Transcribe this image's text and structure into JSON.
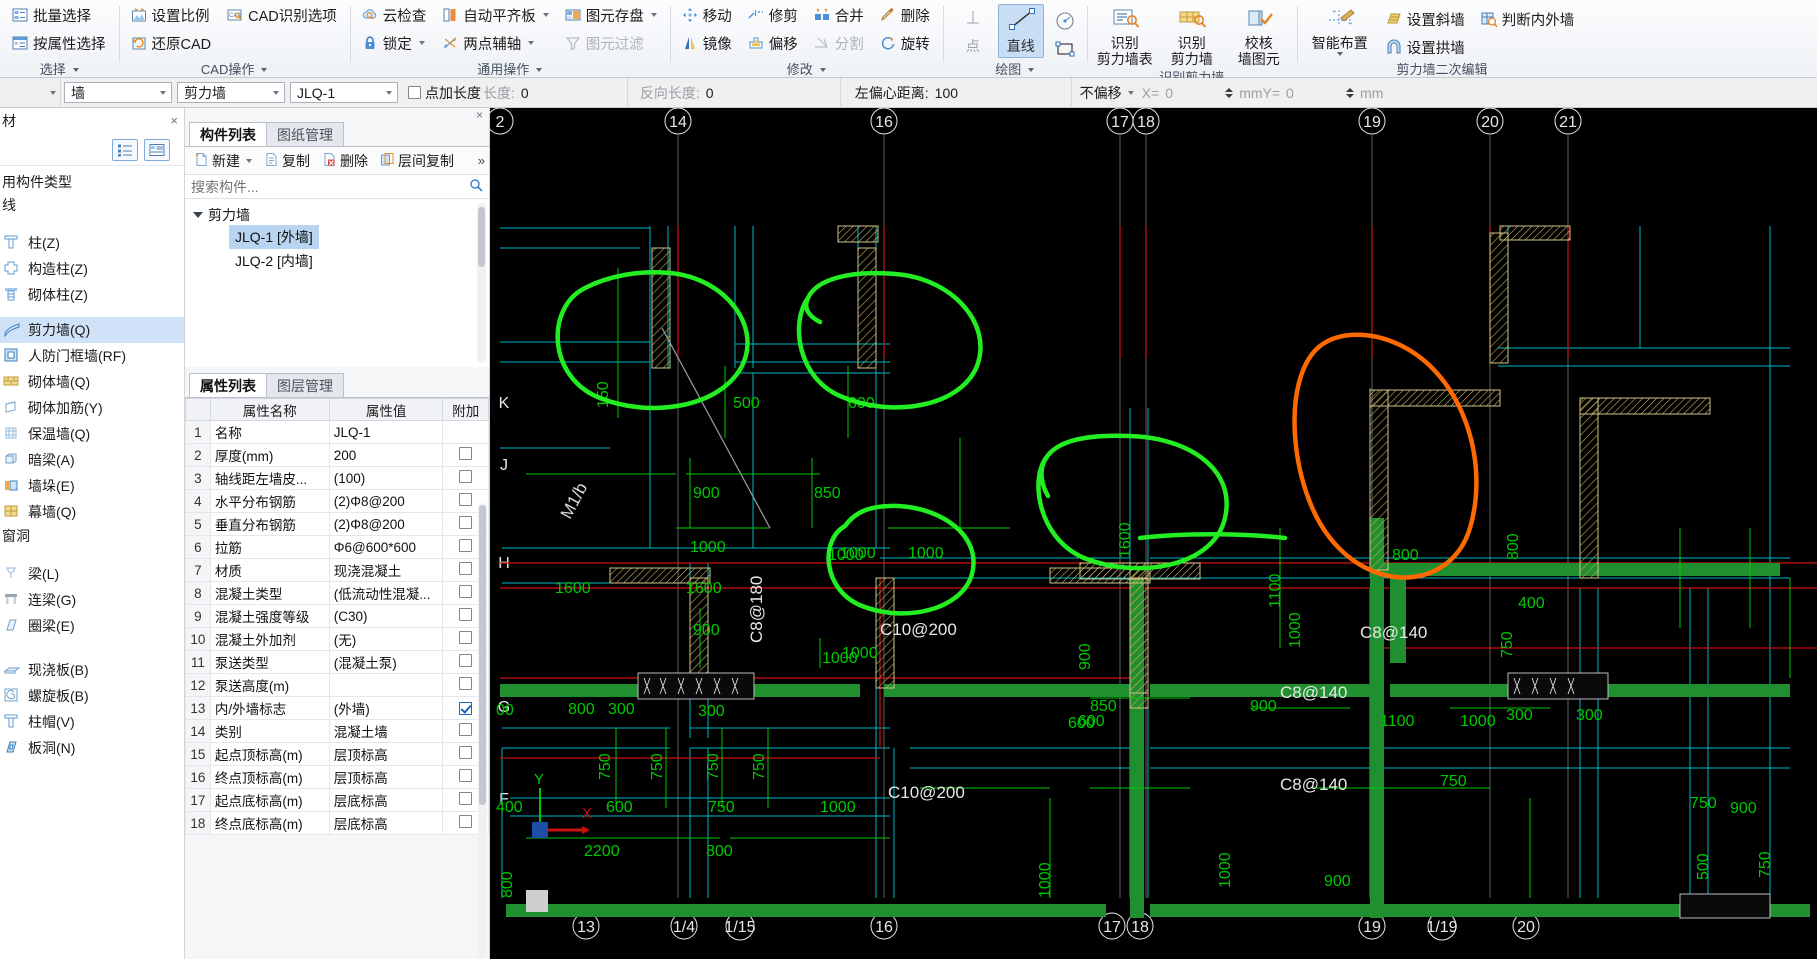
{
  "ribbon": {
    "groups": [
      {
        "title": "选择",
        "items": [
          {
            "label": "批量选择",
            "icon": "batch-select-icon"
          },
          {
            "label": "按属性选择",
            "icon": "select-by-attribute-icon"
          }
        ]
      },
      {
        "title": "CAD操作",
        "items": [
          {
            "label": "设置比例",
            "icon": "set-scale-icon"
          },
          {
            "label": "还原CAD",
            "icon": "restore-cad-icon"
          },
          {
            "label": "CAD识别选项",
            "icon": "cad-recognize-options-icon"
          }
        ]
      },
      {
        "title": "通用操作",
        "items": [
          {
            "label": "云检查",
            "icon": "cloud-check-icon"
          },
          {
            "label": "锁定",
            "icon": "lock-icon"
          },
          {
            "label": "自动平齐板",
            "icon": "auto-align-slab-icon"
          },
          {
            "label": "两点辅轴",
            "icon": "two-point-aux-axis-icon"
          },
          {
            "label": "图元存盘",
            "icon": "element-save-icon"
          },
          {
            "label": "图元过滤",
            "icon": "element-filter-icon"
          }
        ]
      },
      {
        "title": "修改",
        "items": [
          {
            "label": "移动",
            "icon": "move-icon"
          },
          {
            "label": "镜像",
            "icon": "mirror-icon"
          },
          {
            "label": "修剪",
            "icon": "trim-icon"
          },
          {
            "label": "偏移",
            "icon": "offset-icon"
          },
          {
            "label": "合并",
            "icon": "merge-icon"
          },
          {
            "label": "分割",
            "icon": "split-icon"
          },
          {
            "label": "删除",
            "icon": "delete-icon"
          },
          {
            "label": "旋转",
            "icon": "rotate-icon"
          }
        ]
      },
      {
        "title": "绘图",
        "items": [
          {
            "label": "点",
            "icon": "point-tool-icon"
          },
          {
            "label": "直线",
            "icon": "line-tool-icon"
          },
          {
            "label": "弧线",
            "icon": "arc-tool-icon"
          },
          {
            "label": "矩形",
            "icon": "rect-tool-icon"
          }
        ]
      },
      {
        "title": "识别剪力墙",
        "items": [
          {
            "label1": "识别",
            "label2": "剪力墙表",
            "icon": "recognize-shearwall-table-icon"
          },
          {
            "label1": "识别",
            "label2": "剪力墙",
            "icon": "recognize-shearwall-icon"
          },
          {
            "label1": "校核",
            "label2": "墙图元",
            "icon": "check-wall-element-icon"
          }
        ]
      },
      {
        "title": "剪力墙二次编辑",
        "items": [
          {
            "label1": "智能布置",
            "icon": "smart-layout-icon"
          },
          {
            "label": "设置斜墙",
            "icon": "set-slanted-wall-icon"
          },
          {
            "label": "设置拱墙",
            "icon": "set-arch-wall-icon"
          },
          {
            "label": "判断内外墙",
            "icon": "judge-inner-outer-wall-icon"
          }
        ]
      }
    ],
    "active_tool": "直线"
  },
  "optionsbar": {
    "first_combo_value": "",
    "combo_wall": "墙",
    "combo_type": "剪力墙",
    "combo_name": "JLQ-1",
    "checkbox_label": "点加长度",
    "length_label": "长度:",
    "length_value": "0",
    "reverse_length_label": "反向长度:",
    "reverse_length_value": "0",
    "left_eccentric_label": "左偏心距离:",
    "left_eccentric_value": "100",
    "offset_mode": "不偏移",
    "x_label": "X=",
    "x_value": "0",
    "x_unit": "mmY=",
    "y_value": "0",
    "y_unit": "mm"
  },
  "leftnav": {
    "header": "材",
    "section_title": "用构件类型",
    "sub_title": "线",
    "groups": [
      {
        "items": [
          {
            "label": "柱(Z)",
            "icon": "column-icon",
            "selected": false
          },
          {
            "label": "构造柱(Z)",
            "icon": "structural-column-icon",
            "selected": false
          },
          {
            "label": "砌体柱(Z)",
            "icon": "masonry-column-icon",
            "selected": false
          }
        ]
      },
      {
        "items": [
          {
            "label": "剪力墙(Q)",
            "icon": "shear-wall-icon",
            "selected": true
          },
          {
            "label": "人防门框墙(RF)",
            "icon": "civil-defense-door-frame-wall-icon",
            "selected": false
          },
          {
            "label": "砌体墙(Q)",
            "icon": "masonry-wall-icon",
            "selected": false
          },
          {
            "label": "砌体加筋(Y)",
            "icon": "masonry-reinforcement-icon",
            "selected": false
          },
          {
            "label": "保温墙(Q)",
            "icon": "insulation-wall-icon",
            "selected": false
          },
          {
            "label": "暗梁(A)",
            "icon": "concealed-beam-icon",
            "selected": false
          },
          {
            "label": "墙垛(E)",
            "icon": "wall-pier-icon",
            "selected": false
          },
          {
            "label": "幕墙(Q)",
            "icon": "curtain-wall-icon",
            "selected": false
          }
        ],
        "footer": "窗洞"
      },
      {
        "items": [
          {
            "label": "梁(L)",
            "icon": "beam-icon",
            "selected": false
          },
          {
            "label": "连梁(G)",
            "icon": "coupling-beam-icon",
            "selected": false
          },
          {
            "label": "圈梁(E)",
            "icon": "ring-beam-icon",
            "selected": false
          }
        ]
      },
      {
        "items": [
          {
            "label": "现浇板(B)",
            "icon": "cast-in-place-slab-icon",
            "selected": false
          },
          {
            "label": "螺旋板(B)",
            "icon": "spiral-slab-icon",
            "selected": false
          },
          {
            "label": "柱帽(V)",
            "icon": "column-cap-icon",
            "selected": false
          },
          {
            "label": "板洞(N)",
            "icon": "slab-opening-icon",
            "selected": false
          }
        ]
      }
    ]
  },
  "component_panel": {
    "tabs": [
      {
        "label": "构件列表",
        "active": true
      },
      {
        "label": "图纸管理",
        "active": false
      }
    ],
    "toolbar": [
      {
        "label": "新建",
        "icon": "new-icon",
        "has_caret": true
      },
      {
        "label": "复制",
        "icon": "copy-icon",
        "has_caret": false
      },
      {
        "label": "删除",
        "icon": "delete-component-icon",
        "has_caret": false
      },
      {
        "label": "层间复制",
        "icon": "copy-between-floors-icon",
        "has_caret": false
      }
    ],
    "toolbar_more": "»",
    "search_placeholder": "搜索构件...",
    "tree": {
      "root": "剪力墙",
      "children": [
        {
          "label": "JLQ-1 [外墙]",
          "selected": true
        },
        {
          "label": "JLQ-2 [内墙]",
          "selected": false
        }
      ]
    }
  },
  "property_panel": {
    "tabs": [
      {
        "label": "属性列表",
        "active": true
      },
      {
        "label": "图层管理",
        "active": false
      }
    ],
    "columns": [
      "",
      "属性名称",
      "属性值",
      "附加"
    ],
    "rows": [
      {
        "idx": "1",
        "name": "名称",
        "value": "JLQ-1",
        "blue": true,
        "attach": "none"
      },
      {
        "idx": "2",
        "name": "厚度(mm)",
        "value": "200",
        "blue": true,
        "attach": "unchecked"
      },
      {
        "idx": "3",
        "name": "轴线距左墙皮...",
        "value": "(100)",
        "blue": false,
        "attach": "unchecked"
      },
      {
        "idx": "4",
        "name": "水平分布钢筋",
        "value": "(2)Φ8@200",
        "blue": true,
        "attach": "unchecked"
      },
      {
        "idx": "5",
        "name": "垂直分布钢筋",
        "value": "(2)Φ8@200",
        "blue": true,
        "attach": "unchecked"
      },
      {
        "idx": "6",
        "name": "拉筋",
        "value": "Φ6@600*600",
        "blue": true,
        "attach": "unchecked"
      },
      {
        "idx": "7",
        "name": "材质",
        "value": "现浇混凝土",
        "blue": true,
        "attach": "unchecked"
      },
      {
        "idx": "8",
        "name": "混凝土类型",
        "value": "(低流动性混凝...",
        "blue": true,
        "attach": "unchecked"
      },
      {
        "idx": "9",
        "name": "混凝土强度等级",
        "value": "(C30)",
        "blue": true,
        "attach": "unchecked"
      },
      {
        "idx": "10",
        "name": "混凝土外加剂",
        "value": "(无)",
        "blue": true,
        "attach": "unchecked"
      },
      {
        "idx": "11",
        "name": "泵送类型",
        "value": "(混凝土泵)",
        "blue": true,
        "attach": "unchecked"
      },
      {
        "idx": "12",
        "name": "泵送高度(m)",
        "value": "",
        "blue": false,
        "attach": "unchecked"
      },
      {
        "idx": "13",
        "name": "内/外墙标志",
        "value": "(外墙)",
        "blue": false,
        "attach": "checked"
      },
      {
        "idx": "14",
        "name": "类别",
        "value": "混凝土墙",
        "blue": true,
        "attach": "unchecked"
      },
      {
        "idx": "15",
        "name": "起点顶标高(m)",
        "value": "层顶标高",
        "blue": false,
        "attach": "unchecked"
      },
      {
        "idx": "16",
        "name": "终点顶标高(m)",
        "value": "层顶标高",
        "blue": false,
        "attach": "unchecked"
      },
      {
        "idx": "17",
        "name": "起点底标高(m)",
        "value": "层底标高",
        "blue": false,
        "attach": "unchecked"
      },
      {
        "idx": "18",
        "name": "终点底标高(m)",
        "value": "层底标高",
        "blue": false,
        "attach": "unchecked"
      }
    ]
  },
  "canvas": {
    "background": "#000000",
    "colors": {
      "dim_green": "#00c800",
      "annotation_green": "#22ee22",
      "annotation_orange": "#ff6a00",
      "wall_cyan": "#00b7c8",
      "wall_red": "#cc1111",
      "grid_white": "#e8e8e8",
      "hatch_yellow": "#b9a24a",
      "solid_green": "#1f8f2f"
    },
    "top_axis_labels": [
      "2",
      "14",
      "16",
      "17",
      "18",
      "19",
      "20",
      "21"
    ],
    "bottom_axis_labels": [
      "13",
      "1/4",
      "1/15",
      "16",
      "17",
      "18",
      "19",
      "1/19",
      "20"
    ],
    "left_axis_labels": [
      "K",
      "J",
      "H",
      "G",
      "F"
    ],
    "dimension_texts": [
      "150",
      "500",
      "600",
      "900",
      "850",
      "1000",
      "1000",
      "1600",
      "1600",
      "900",
      "1100",
      "800",
      "800",
      "400",
      "750",
      "1000",
      "900",
      "750",
      "600",
      "850",
      "600",
      "800",
      "300",
      "300",
      "750",
      "750",
      "750",
      "750",
      "400",
      "600",
      "750",
      "1000",
      "1100",
      "1000",
      "900",
      "900",
      "2200",
      "800",
      "1000",
      "1000",
      "500",
      "750",
      "900",
      "300",
      "300",
      "800"
    ],
    "rebar_labels": [
      "C8@180",
      "C10@200",
      "C8@140",
      "C10@200",
      "C8@140",
      "C8@140"
    ],
    "axis_origin_labels": [
      "Y",
      "X"
    ],
    "annotations": [
      {
        "shape": "ellipse",
        "color": "#22ee22",
        "name": "green-circle-1"
      },
      {
        "shape": "ellipse",
        "color": "#22ee22",
        "name": "green-circle-2"
      },
      {
        "shape": "ellipse",
        "color": "#22ee22",
        "name": "green-circle-3"
      },
      {
        "shape": "ellipse",
        "color": "#22ee22",
        "name": "green-circle-4"
      },
      {
        "shape": "line",
        "color": "#22ee22",
        "name": "green-underline"
      },
      {
        "shape": "ellipse",
        "color": "#ff6a00",
        "name": "orange-circle-1"
      }
    ]
  }
}
